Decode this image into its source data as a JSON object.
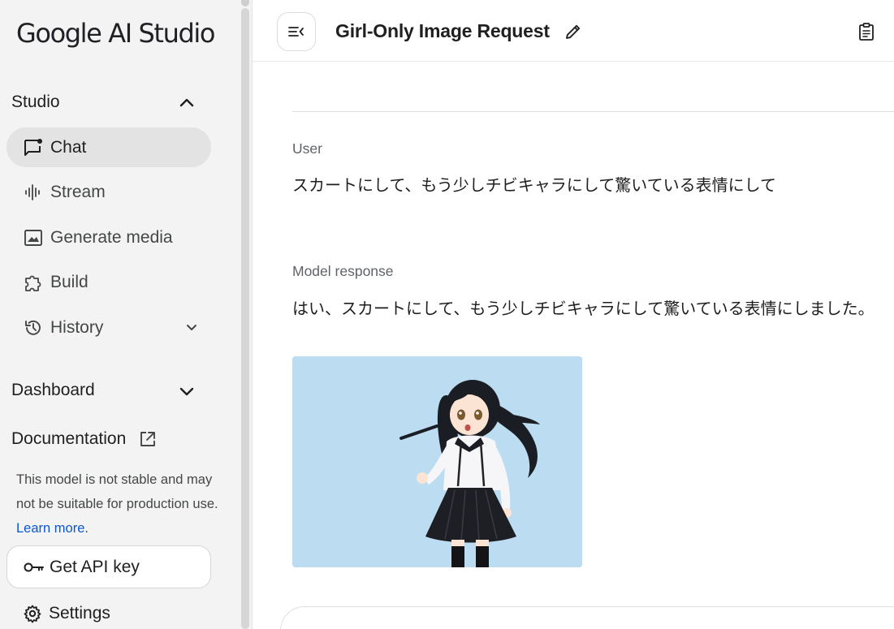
{
  "app": {
    "logo_text": "Google AI Studio"
  },
  "sidebar": {
    "studio_label": "Studio",
    "items": [
      {
        "label": "Chat",
        "icon": "chat-icon",
        "active": true
      },
      {
        "label": "Stream",
        "icon": "stream-icon"
      },
      {
        "label": "Generate media",
        "icon": "image-icon"
      },
      {
        "label": "Build",
        "icon": "puzzle-icon"
      },
      {
        "label": "History",
        "icon": "history-icon"
      }
    ],
    "dashboard_label": "Dashboard",
    "documentation_label": "Documentation",
    "note_text": "This model is not stable and may not be suitable for production use.",
    "learn_more": "Learn more",
    "note_suffix": ".",
    "api_key_label": "Get API key",
    "settings_label": "Settings"
  },
  "header": {
    "title": "Girl-Only Image Request",
    "icons": [
      "sidebar-toggle-icon",
      "edit-pencil-icon",
      "clipboard-icon"
    ]
  },
  "chat": {
    "user_role": "User",
    "user_message": "スカートにして、もう少しチビキャラにして驚いている表情にして",
    "model_role": "Model response",
    "model_message": "はい、スカートにして、もう少しチビキャラにして驚いている表情にしました。"
  },
  "colors": {
    "link": "#0b57d0",
    "sidebar_bg": "#f3f3f3",
    "active_bg": "#e3e3e3",
    "image_bg": "#bcdcf1"
  }
}
